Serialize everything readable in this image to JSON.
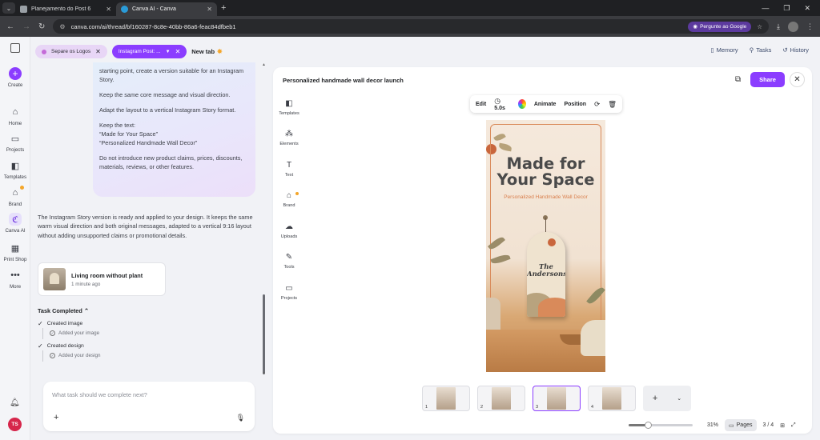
{
  "browser": {
    "tabs": [
      {
        "title": "Planejamento do Post 6"
      },
      {
        "title": "Canva AI - Canva"
      }
    ],
    "url": "canva.com/ai/thread/bf160287-8c8e-40bb-86a6-feac84dfbeb1",
    "google_button": "Pergunte ao Google"
  },
  "rail": {
    "items": [
      {
        "label": "Create"
      },
      {
        "label": "Home"
      },
      {
        "label": "Projects"
      },
      {
        "label": "Templates"
      },
      {
        "label": "Brand"
      },
      {
        "label": "Canva AI"
      },
      {
        "label": "Print Shop"
      },
      {
        "label": "More"
      }
    ],
    "avatar_initials": "TS"
  },
  "chat_tabs": [
    {
      "label": "Separe os Logos"
    },
    {
      "label": "Instagram Post: ..."
    },
    {
      "label": "New tab"
    }
  ],
  "top_links": {
    "memory": "Memory",
    "tasks": "Tasks",
    "history": "History"
  },
  "prompt_bubble": {
    "p1": "starting point, create a version suitable for an Instagram Story.",
    "p2": "Keep the same core message and visual direction.",
    "p3": "Adapt the layout to a vertical Instagram Story format.",
    "p4a": "Keep the text:",
    "p4b": "“Made for Your Space”",
    "p4c": "“Personalized Handmade Wall Decor”",
    "p5": "Do not introduce new product claims, prices, discounts, materials, reviews, or other features."
  },
  "reply": "The Instagram Story version is ready and applied to your design. It keeps the same warm visual direction and both original messages, adapted to a vertical 9:16 layout without adding unsupported claims or promotional details.",
  "result_card": {
    "title": "Living room without plant",
    "time": "1 minute ago"
  },
  "tasks": {
    "heading": "Task Completed",
    "items": [
      {
        "title": "Created image",
        "sub": "Added your image"
      },
      {
        "title": "Created design",
        "sub": "Added your design"
      }
    ]
  },
  "composer": {
    "placeholder": "What task should we complete next?"
  },
  "editor": {
    "title": "Personalized handmade wall decor launch",
    "share": "Share",
    "side": [
      {
        "label": "Templates"
      },
      {
        "label": "Elements"
      },
      {
        "label": "Text"
      },
      {
        "label": "Brand"
      },
      {
        "label": "Uploads"
      },
      {
        "label": "Tools"
      },
      {
        "label": "Projects"
      }
    ],
    "toolbar": {
      "edit": "Edit",
      "duration": "5.0s",
      "animate": "Animate",
      "position": "Position"
    },
    "design": {
      "title_line1": "Made for",
      "title_line2": "Your Space",
      "subtitle": "Personalized Handmade Wall Decor",
      "name": "The Andersons"
    },
    "pages": {
      "thumbs": [
        {
          "num": "1"
        },
        {
          "num": "2"
        },
        {
          "num": "3"
        },
        {
          "num": "4"
        }
      ],
      "selected": 3,
      "zoom": "31%",
      "zoom_fraction": 0.31,
      "pages_label": "Pages",
      "counter": "3 / 4"
    }
  },
  "colors": {
    "accent": "#8b3dff",
    "brand_dot": "#f4a62a",
    "avatar": "#d6264b"
  }
}
